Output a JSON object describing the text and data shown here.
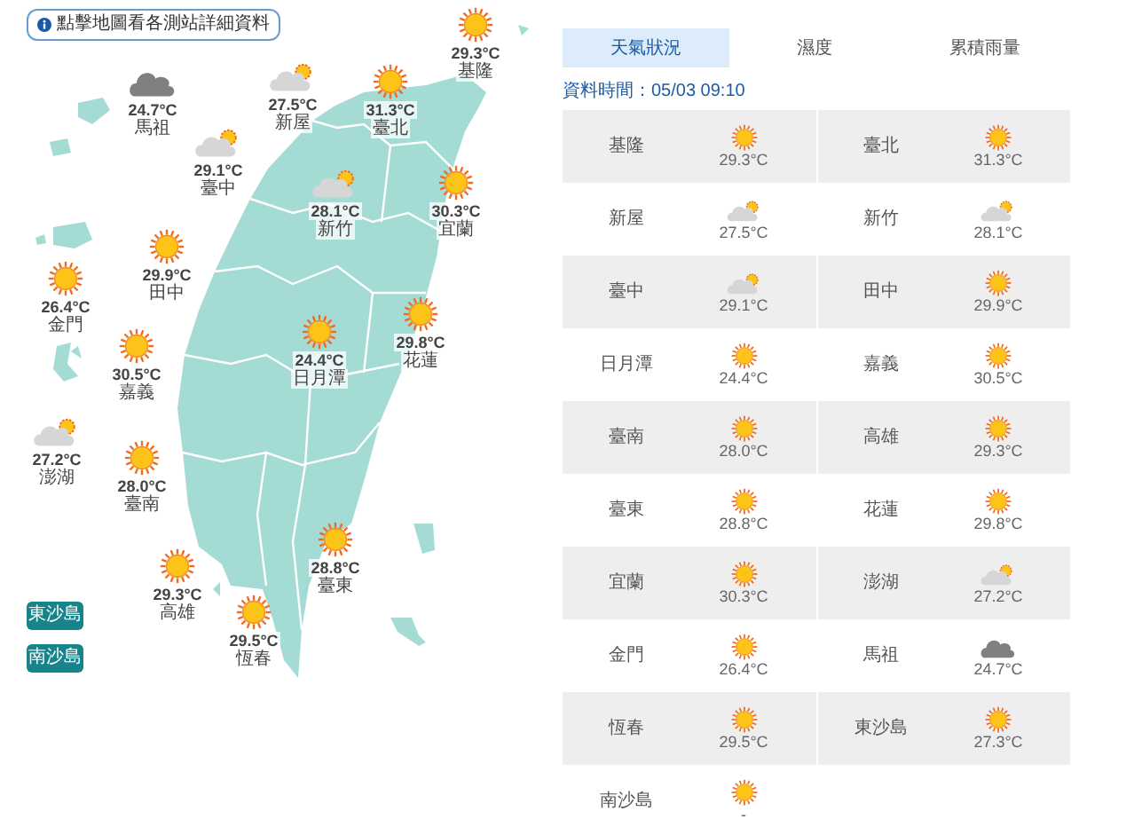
{
  "map_hint": "點擊地圖看各測站詳細資料",
  "map_stations": [
    {
      "name": "基隆",
      "temp": "29.3°C",
      "kind": "sunny"
    },
    {
      "name": "馬祖",
      "temp": "24.7°C",
      "kind": "cloudy"
    },
    {
      "name": "新屋",
      "temp": "27.5°C",
      "kind": "partly"
    },
    {
      "name": "臺北",
      "temp": "31.3°C",
      "kind": "sunny"
    },
    {
      "name": "臺中",
      "temp": "29.1°C",
      "kind": "partly"
    },
    {
      "name": "新竹",
      "temp": "28.1°C",
      "kind": "partly"
    },
    {
      "name": "宜蘭",
      "temp": "30.3°C",
      "kind": "sunny"
    },
    {
      "name": "田中",
      "temp": "29.9°C",
      "kind": "sunny"
    },
    {
      "name": "金門",
      "temp": "26.4°C",
      "kind": "sunny"
    },
    {
      "name": "嘉義",
      "temp": "30.5°C",
      "kind": "sunny"
    },
    {
      "name": "日月潭",
      "temp": "24.4°C",
      "kind": "sunny"
    },
    {
      "name": "花蓮",
      "temp": "29.8°C",
      "kind": "sunny"
    },
    {
      "name": "澎湖",
      "temp": "27.2°C",
      "kind": "partly"
    },
    {
      "name": "臺南",
      "temp": "28.0°C",
      "kind": "sunny"
    },
    {
      "name": "高雄",
      "temp": "29.3°C",
      "kind": "sunny"
    },
    {
      "name": "恆春",
      "temp": "29.5°C",
      "kind": "sunny"
    },
    {
      "name": "臺東",
      "temp": "28.8°C",
      "kind": "sunny"
    }
  ],
  "island_buttons": [
    "東沙島",
    "南沙島"
  ],
  "tabs": [
    {
      "label": "天氣狀況",
      "selected": true
    },
    {
      "label": "濕度",
      "selected": false
    },
    {
      "label": "累積雨量",
      "selected": false
    }
  ],
  "data_time": "資料時間：05/03 09:10",
  "list": [
    {
      "name": "基隆",
      "temp": "29.3°C",
      "kind": "sunny"
    },
    {
      "name": "臺北",
      "temp": "31.3°C",
      "kind": "sunny"
    },
    {
      "name": "新屋",
      "temp": "27.5°C",
      "kind": "partly"
    },
    {
      "name": "新竹",
      "temp": "28.1°C",
      "kind": "partly"
    },
    {
      "name": "臺中",
      "temp": "29.1°C",
      "kind": "partly"
    },
    {
      "name": "田中",
      "temp": "29.9°C",
      "kind": "sunny"
    },
    {
      "name": "日月潭",
      "temp": "24.4°C",
      "kind": "sunny"
    },
    {
      "name": "嘉義",
      "temp": "30.5°C",
      "kind": "sunny"
    },
    {
      "name": "臺南",
      "temp": "28.0°C",
      "kind": "sunny"
    },
    {
      "name": "高雄",
      "temp": "29.3°C",
      "kind": "sunny"
    },
    {
      "name": "臺東",
      "temp": "28.8°C",
      "kind": "sunny"
    },
    {
      "name": "花蓮",
      "temp": "29.8°C",
      "kind": "sunny"
    },
    {
      "name": "宜蘭",
      "temp": "30.3°C",
      "kind": "sunny"
    },
    {
      "name": "澎湖",
      "temp": "27.2°C",
      "kind": "partly"
    },
    {
      "name": "金門",
      "temp": "26.4°C",
      "kind": "sunny"
    },
    {
      "name": "馬祖",
      "temp": "24.7°C",
      "kind": "cloudy"
    },
    {
      "name": "恆春",
      "temp": "29.5°C",
      "kind": "sunny"
    },
    {
      "name": "東沙島",
      "temp": "27.3°C",
      "kind": "sunny"
    },
    {
      "name": "南沙島",
      "temp": "-",
      "kind": "sunny"
    }
  ]
}
